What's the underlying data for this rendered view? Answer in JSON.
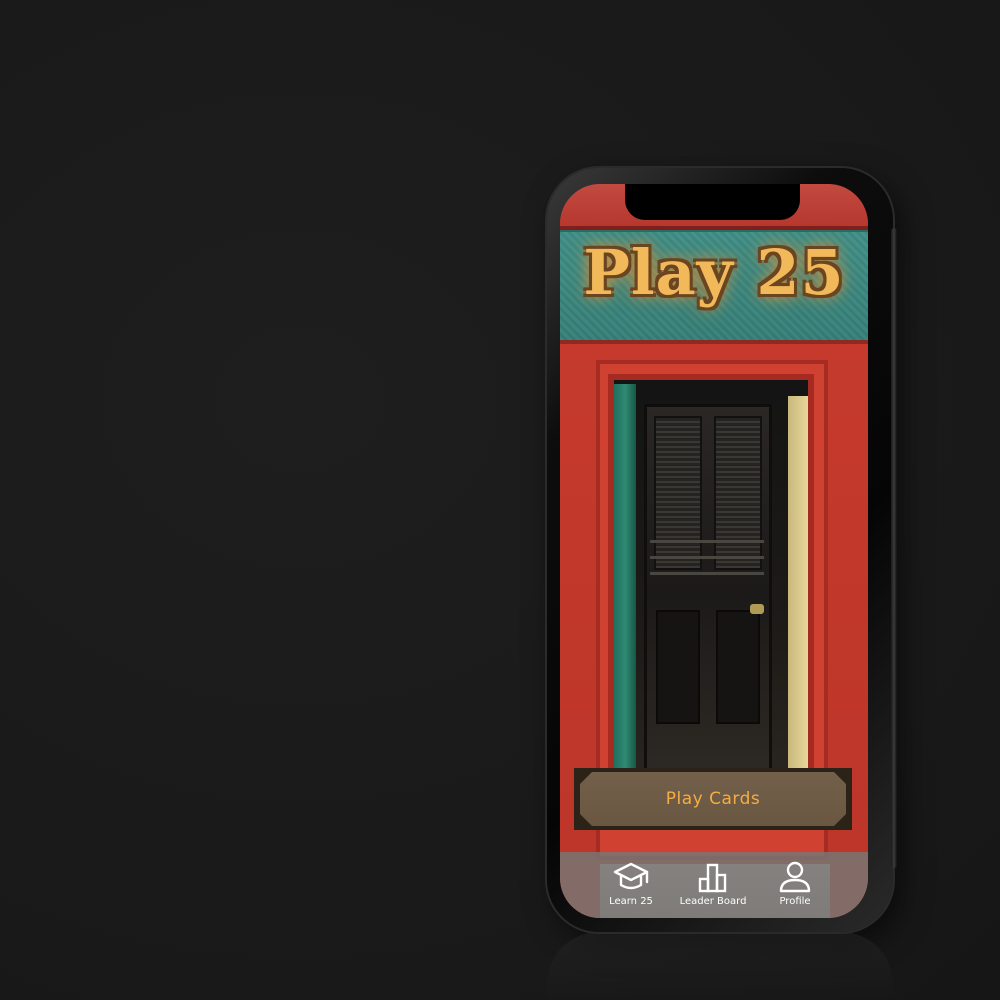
{
  "app": {
    "title": "Play 25"
  },
  "main": {
    "play_button_label": "Play Cards"
  },
  "bottom_nav": {
    "items": [
      {
        "label": "Learn 25",
        "icon": "graduation-cap-icon"
      },
      {
        "label": "Leader Board",
        "icon": "leaderboard-icon"
      },
      {
        "label": "Profile",
        "icon": "profile-icon"
      }
    ]
  },
  "colors": {
    "background": "#1c1c1c",
    "title_gold": "#f2b95a",
    "button_text": "#f4ad45",
    "button_fill": "#73604a",
    "facade_red": "#c53a2c",
    "sign_teal": "#3f8f86"
  }
}
